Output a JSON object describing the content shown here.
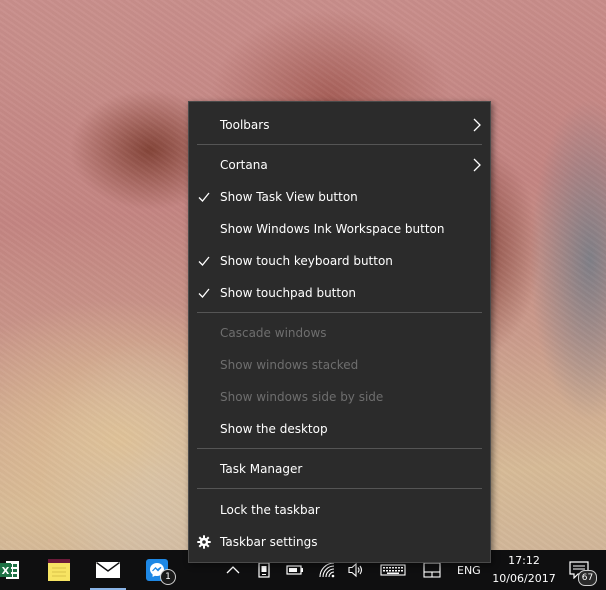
{
  "context_menu": {
    "items": [
      {
        "label": "Toolbars",
        "has_submenu": true,
        "checked": false,
        "enabled": true
      },
      {
        "label": "Cortana",
        "has_submenu": true,
        "checked": false,
        "enabled": true
      },
      {
        "label": "Show Task View button",
        "has_submenu": false,
        "checked": true,
        "enabled": true
      },
      {
        "label": "Show Windows Ink Workspace button",
        "has_submenu": false,
        "checked": false,
        "enabled": true
      },
      {
        "label": "Show touch keyboard button",
        "has_submenu": false,
        "checked": true,
        "enabled": true
      },
      {
        "label": "Show touchpad button",
        "has_submenu": false,
        "checked": true,
        "enabled": true
      },
      {
        "label": "Cascade windows",
        "has_submenu": false,
        "checked": false,
        "enabled": false
      },
      {
        "label": "Show windows stacked",
        "has_submenu": false,
        "checked": false,
        "enabled": false
      },
      {
        "label": "Show windows side by side",
        "has_submenu": false,
        "checked": false,
        "enabled": false
      },
      {
        "label": "Show the desktop",
        "has_submenu": false,
        "checked": false,
        "enabled": true
      },
      {
        "label": "Task Manager",
        "has_submenu": false,
        "checked": false,
        "enabled": true
      },
      {
        "label": "Lock the taskbar",
        "has_submenu": false,
        "checked": false,
        "enabled": true
      },
      {
        "label": "Taskbar settings",
        "has_submenu": false,
        "checked": false,
        "enabled": true,
        "icon": "gear-icon"
      }
    ]
  },
  "taskbar": {
    "apps": [
      {
        "name": "excel-icon",
        "label": "X"
      },
      {
        "name": "sticky-notes-icon"
      },
      {
        "name": "mail-icon"
      },
      {
        "name": "messenger-icon",
        "badge": "1"
      }
    ],
    "tray": {
      "icons": [
        "chevron-up-icon",
        "device-icon",
        "battery-icon",
        "wifi-icon",
        "volume-icon",
        "touch-keyboard-icon",
        "touchpad-icon"
      ],
      "language": "ENG",
      "time": "17:12",
      "date": "10/06/2017",
      "notification_count": "67"
    }
  },
  "colors": {
    "menu_bg": "#2b2b2b",
    "menu_text": "#ffffff",
    "menu_disabled_text": "#6e6e6e",
    "taskbar_bg": "#0f0f10",
    "excel_green": "#1e7145",
    "messenger_blue": "#1e88e5"
  }
}
